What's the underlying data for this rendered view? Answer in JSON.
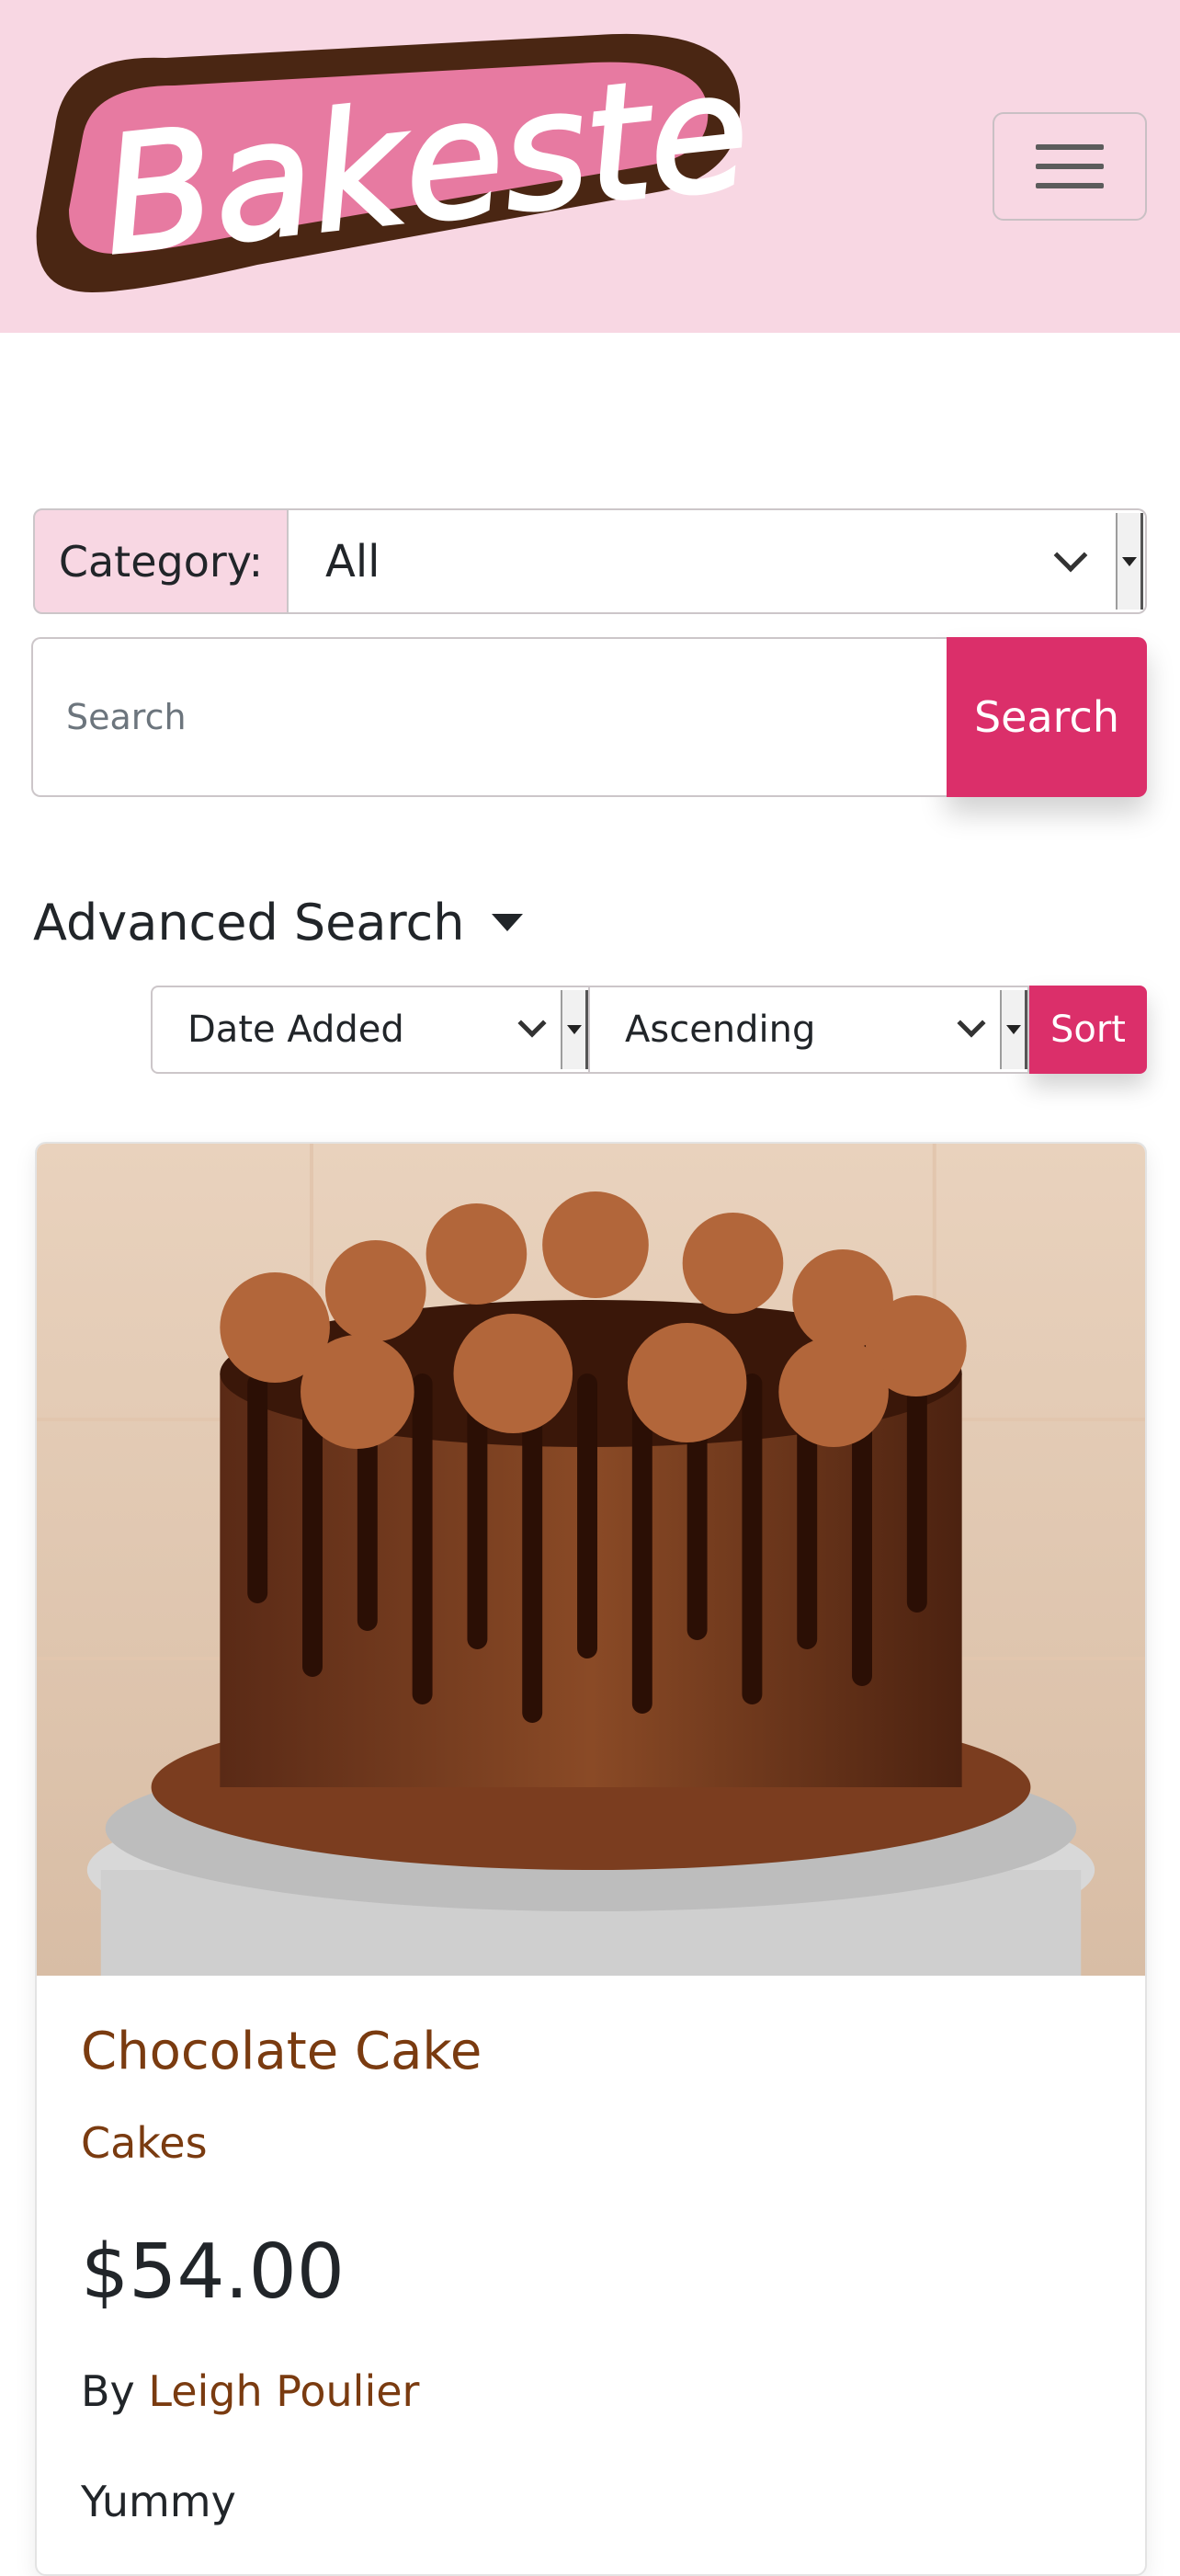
{
  "header": {
    "logo_text": "Bakester",
    "menu_toggle": "menu-icon"
  },
  "filters": {
    "category_label": "Category:",
    "category_value": "All",
    "search_placeholder": "Search",
    "search_button": "Search"
  },
  "advanced": {
    "label": "Advanced Search",
    "sort_by_value": "Date Added",
    "order_value": "Ascending",
    "sort_button": "Sort"
  },
  "product": {
    "title": "Chocolate Cake",
    "category": "Cakes",
    "price": "$54.00",
    "by_prefix": "By",
    "author": "Leigh Poulier",
    "description": "Yummy",
    "image": "chocolate-drip-cake-photo"
  },
  "colors": {
    "header_bg": "#f8d7e3",
    "accent": "#db2f6a",
    "link": "#7a3b10",
    "logo_pink": "#e77aa1",
    "logo_brown": "#4a2613"
  }
}
